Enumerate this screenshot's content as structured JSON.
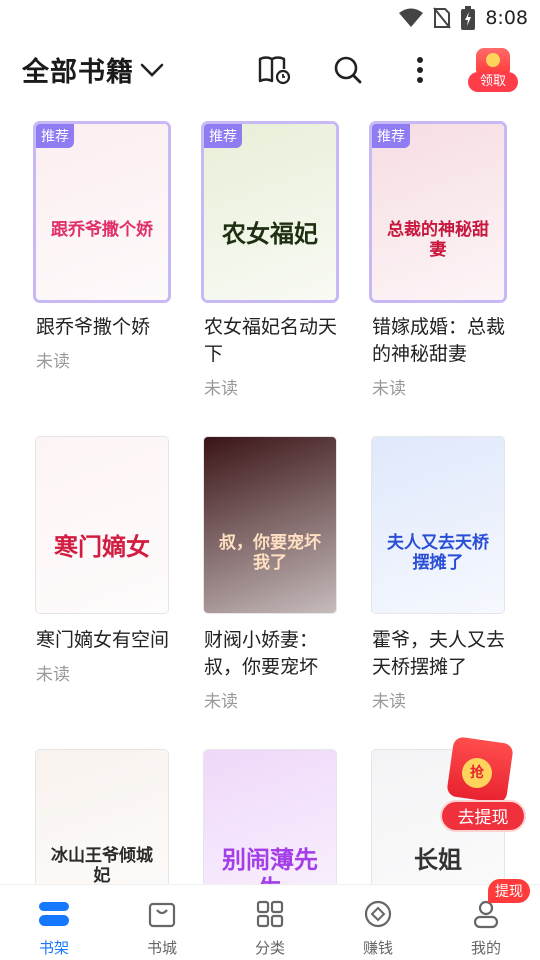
{
  "status_bar": {
    "time": "8:08"
  },
  "header": {
    "title": "全部书籍",
    "redpacket_label": "领取"
  },
  "books": [
    {
      "name": "跟乔爷撒个娇",
      "status": "未读",
      "tag": "推荐",
      "cover_title": "跟乔爷撒个娇",
      "cover_color": "#fbeef0",
      "accent": "#e0306a"
    },
    {
      "name": "农女福妃名动天下",
      "status": "未读",
      "tag": "推荐",
      "cover_title": "农女福妃",
      "cover_color": "#e8efd8",
      "accent": "#1f2f12"
    },
    {
      "name": "错嫁成婚：总裁的神秘甜妻",
      "status": "未读",
      "tag": "推荐",
      "cover_title": "总裁的神秘甜妻",
      "cover_color": "#f6dde3",
      "accent": "#c8183e"
    },
    {
      "name": "寒门嫡女有空间",
      "status": "未读",
      "tag": "",
      "cover_title": "寒门嫡女",
      "cover_color": "#fdf4f5",
      "accent": "#d21d42"
    },
    {
      "name": "财阀小娇妻：叔，你要宠坏",
      "status": "未读",
      "tag": "",
      "cover_title": "叔，你要宠坏我了",
      "cover_color": "#3a1416",
      "accent": "#ffe0c2"
    },
    {
      "name": "霍爷，夫人又去天桥摆摊了",
      "status": "未读",
      "tag": "",
      "cover_title": "夫人又去天桥摆摊了",
      "cover_color": "#dfe8fb",
      "accent": "#2a4fd6"
    },
    {
      "name": "",
      "status": "",
      "tag": "",
      "cover_title": "冰山王爷倾城妃",
      "cover_color": "#f9f3ef",
      "accent": "#2b2b2b"
    },
    {
      "name": "",
      "status": "",
      "tag": "",
      "cover_title": "别闹薄先生",
      "cover_color": "#efd8fa",
      "accent": "#a43ee8"
    },
    {
      "name": "",
      "status": "",
      "tag": "",
      "cover_title": "长姐",
      "cover_color": "#f4f4f6",
      "accent": "#333333"
    }
  ],
  "float_pack": {
    "coin": "抢",
    "label": "去提现"
  },
  "nav": [
    {
      "label": "书架",
      "icon": "bookshelf-icon",
      "active": true
    },
    {
      "label": "书城",
      "icon": "bag-icon"
    },
    {
      "label": "分类",
      "icon": "grid-icon"
    },
    {
      "label": "赚钱",
      "icon": "coin-icon"
    },
    {
      "label": "我的",
      "icon": "person-icon",
      "badge": "提现"
    }
  ],
  "colors": {
    "accent_blue": "#1678ff",
    "tag_purple": "#8f7cf2",
    "red": "#f0303d"
  }
}
